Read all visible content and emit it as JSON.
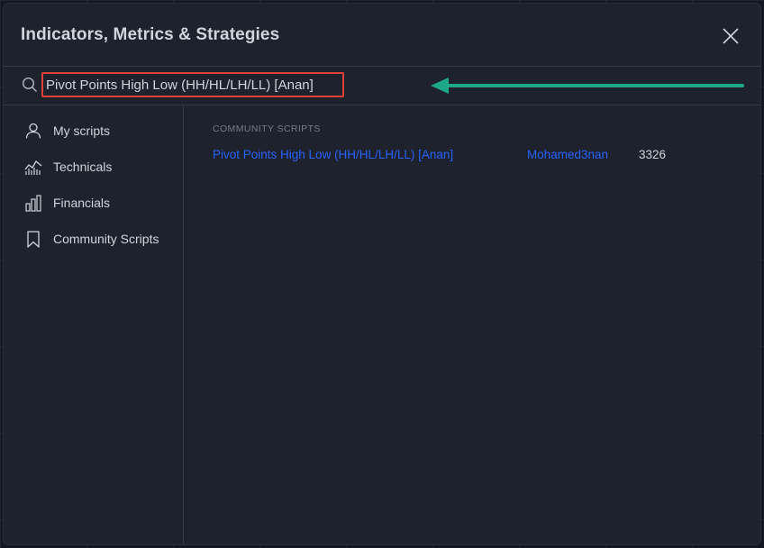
{
  "dialog": {
    "title": "Indicators, Metrics & Strategies",
    "close_icon": "close-icon"
  },
  "search": {
    "value": "Pivot Points High Low (HH/HL/LH/LL) [Anan]",
    "icon": "search-icon",
    "highlight_color": "#e0403a"
  },
  "annotation": {
    "arrow_color": "#1ea88a",
    "icon": "left-arrow-icon"
  },
  "sidebar": {
    "items": [
      {
        "label": "My scripts",
        "icon": "user-icon"
      },
      {
        "label": "Technicals",
        "icon": "chart-line-icon"
      },
      {
        "label": "Financials",
        "icon": "bar-chart-icon"
      },
      {
        "label": "Community Scripts",
        "icon": "bookmark-icon"
      }
    ]
  },
  "main": {
    "section_label": "COMMUNITY SCRIPTS",
    "results": [
      {
        "name": "Pivot Points High Low (HH/HL/LH/LL) [Anan]",
        "author": "Mohamed3nan",
        "count": "3326"
      }
    ]
  },
  "colors": {
    "background": "#131722",
    "dialog": "#1e222d",
    "link": "#2962ff",
    "text": "#d1d4dc",
    "muted": "#787b86"
  }
}
